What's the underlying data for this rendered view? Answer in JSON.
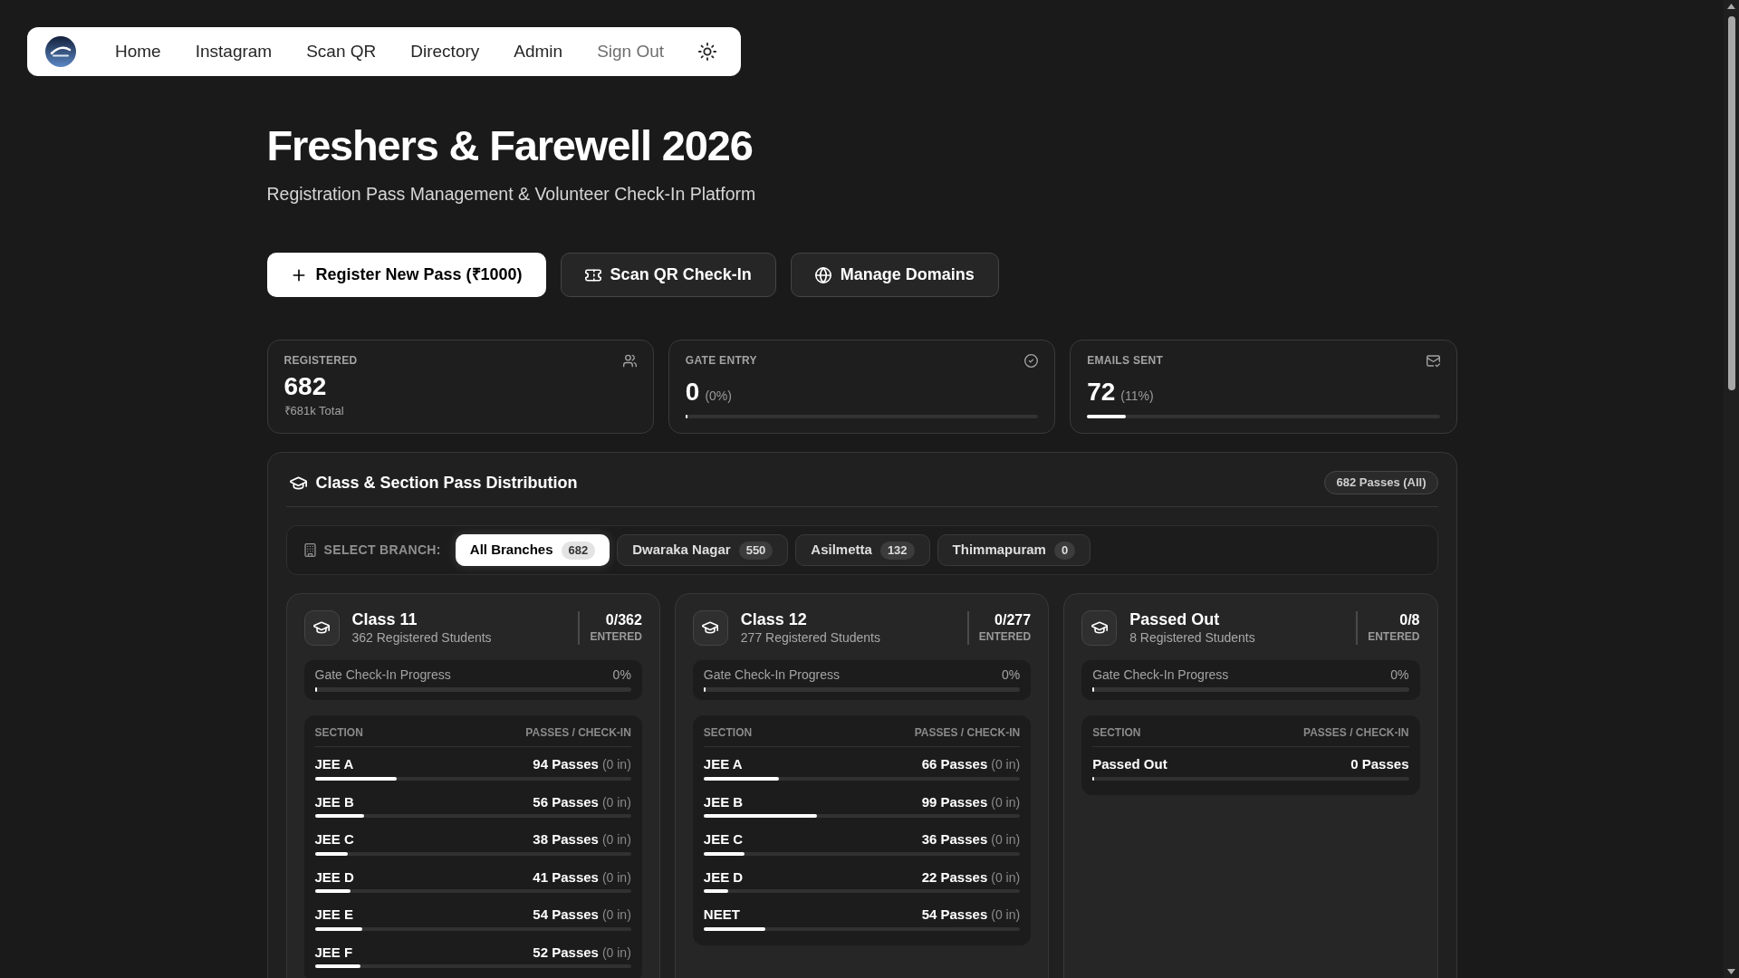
{
  "nav": {
    "items": [
      {
        "label": "Home",
        "kind": "link"
      },
      {
        "label": "Instagram",
        "kind": "link"
      },
      {
        "label": "Scan QR",
        "kind": "link"
      },
      {
        "label": "Directory",
        "kind": "link"
      },
      {
        "label": "Admin",
        "kind": "link"
      },
      {
        "label": "Sign Out",
        "kind": "signout"
      }
    ]
  },
  "hero": {
    "title": "Freshers & Farewell 2026",
    "subtitle": "Registration Pass Management & Volunteer Check-In Platform"
  },
  "actions": [
    {
      "label": "Register New Pass (₹1000)",
      "kind": "primary"
    },
    {
      "label": "Scan QR Check-In",
      "kind": "secondary"
    },
    {
      "label": "Manage Domains",
      "kind": "secondary"
    }
  ],
  "stats": [
    {
      "label": "REGISTERED",
      "kind": "total",
      "value": "682",
      "note": "₹681k Total"
    },
    {
      "label": "GATE ENTRY",
      "kind": "progress",
      "value": "0",
      "percent": "(0%)",
      "level": 0
    },
    {
      "label": "EMAILS SENT",
      "kind": "progress",
      "value": "72",
      "percent": "(11%)",
      "level": 0.11
    }
  ],
  "distribution": {
    "title": "Class & Section Pass Distribution",
    "badge": "682 Passes (All)",
    "branch_label": "SELECT BRANCH:",
    "branches": [
      {
        "name": "All Branches",
        "count": "682",
        "selected": true
      },
      {
        "name": "Dwaraka Nagar",
        "count": "550",
        "selected": false
      },
      {
        "name": "Asilmetta",
        "count": "132",
        "selected": false
      },
      {
        "name": "Thimmapuram",
        "count": "0",
        "selected": false
      }
    ],
    "classes": [
      {
        "name": "Class 11",
        "subtitle": "362 Registered Students",
        "entered": "0/362",
        "entered_label": "ENTERED",
        "progress": {
          "label": "Gate Check-In Progress",
          "value": "0%",
          "level": 0
        },
        "columns": [
          "SECTION",
          "PASSES / CHECK-IN"
        ],
        "sections": [
          {
            "name": "JEE A",
            "passes": "94 Passes",
            "checkin": "(0 in)",
            "level": 0.26
          },
          {
            "name": "JEE B",
            "passes": "56 Passes",
            "checkin": "(0 in)",
            "level": 0.155
          },
          {
            "name": "JEE C",
            "passes": "38 Passes",
            "checkin": "(0 in)",
            "level": 0.105
          },
          {
            "name": "JEE D",
            "passes": "41 Passes",
            "checkin": "(0 in)",
            "level": 0.113
          },
          {
            "name": "JEE E",
            "passes": "54 Passes",
            "checkin": "(0 in)",
            "level": 0.149
          },
          {
            "name": "JEE F",
            "passes": "52 Passes",
            "checkin": "(0 in)",
            "level": 0.144
          }
        ]
      },
      {
        "name": "Class 12",
        "subtitle": "277 Registered Students",
        "entered": "0/277",
        "entered_label": "ENTERED",
        "progress": {
          "label": "Gate Check-In Progress",
          "value": "0%",
          "level": 0
        },
        "columns": [
          "SECTION",
          "PASSES / CHECK-IN"
        ],
        "sections": [
          {
            "name": "JEE A",
            "passes": "66 Passes",
            "checkin": "(0 in)",
            "level": 0.238
          },
          {
            "name": "JEE B",
            "passes": "99 Passes",
            "checkin": "(0 in)",
            "level": 0.357
          },
          {
            "name": "JEE C",
            "passes": "36 Passes",
            "checkin": "(0 in)",
            "level": 0.13
          },
          {
            "name": "JEE D",
            "passes": "22 Passes",
            "checkin": "(0 in)",
            "level": 0.079
          },
          {
            "name": "NEET",
            "passes": "54 Passes",
            "checkin": "(0 in)",
            "level": 0.195
          }
        ]
      },
      {
        "name": "Passed Out",
        "subtitle": "8 Registered Students",
        "entered": "0/8",
        "entered_label": "ENTERED",
        "progress": {
          "label": "Gate Check-In Progress",
          "value": "0%",
          "level": 0
        },
        "columns": [
          "SECTION",
          "PASSES / CHECK-IN"
        ],
        "sections": [
          {
            "name": "Passed Out",
            "passes": "0 Passes",
            "level": 0
          }
        ]
      }
    ]
  }
}
